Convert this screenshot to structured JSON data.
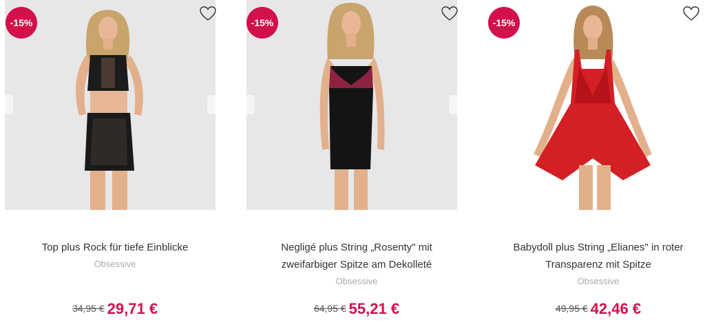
{
  "colors": {
    "accent": "#d2114b",
    "image_bg": "#e7e7e8"
  },
  "products": [
    {
      "badge": "-15%",
      "title": "Top plus Rock für tiefe Einblicke",
      "brand": "Obsessive",
      "old_price": "34,95 €",
      "new_price": "29,71 €",
      "image": "model-black-lace-top-and-skirt"
    },
    {
      "badge": "-15%",
      "title": "Negligé plus String „Rosenty\" mit zweifarbiger Spitze am Dekolleté",
      "brand": "Obsessive",
      "old_price": "64,95 €",
      "new_price": "55,21 €",
      "image": "model-black-negligee-with-red-lace"
    },
    {
      "badge": "-15%",
      "title": "Babydoll plus String „Elianes\" in roter Transparenz mit Spitze",
      "brand": "Obsessive",
      "old_price": "49,95 €",
      "new_price": "42,46 €",
      "image": "model-red-babydoll"
    }
  ]
}
